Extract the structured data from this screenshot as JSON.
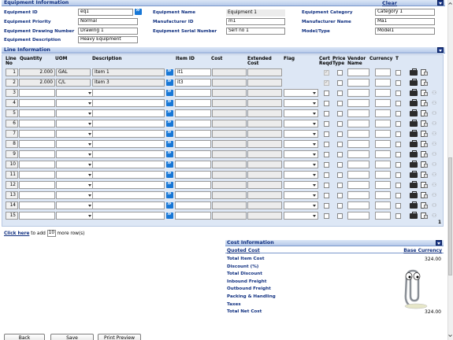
{
  "equipment": {
    "section_title": "Equipment Information",
    "clear_label": "Clear",
    "fields": {
      "equipment_id": {
        "label": "Equipment ID",
        "value": "eq1"
      },
      "equipment_priority": {
        "label": "Equipment Priority",
        "value": "Normal"
      },
      "drawing_number": {
        "label": "Equipment Drawing Number",
        "value": "Drawing 1"
      },
      "description": {
        "label": "Equipment Description",
        "value": "Heavy Equipment"
      },
      "equipment_name": {
        "label": "Equipment Name",
        "value": "Equipment 1"
      },
      "manufacturer_id": {
        "label": "Manufacturer ID",
        "value": "m1"
      },
      "serial_number": {
        "label": "Equipment Serial Number",
        "value": "Serl no 1"
      },
      "category": {
        "label": "Equipment Category",
        "value": "Category 1"
      },
      "manufacturer_name": {
        "label": "Manufacturer Name",
        "value": "Ma1"
      },
      "model_type": {
        "label": "Model/Type",
        "value": "Model1"
      }
    }
  },
  "lines": {
    "section_title": "Line Information",
    "headers": {
      "line_no": "Line No",
      "quantity": "Quantity",
      "uom": "UOM",
      "description": "Description",
      "item_id": "Item ID",
      "cost": "Cost",
      "extended_cost": "Extended Cost",
      "flag": "Flag",
      "cert_reqd": "Cert Reqd",
      "price_type": "Price Type",
      "vendor_name": "Vendor Name",
      "currency": "Currency",
      "t": "T"
    },
    "rows": [
      {
        "no": "1",
        "qty": "2.000",
        "uom": "GAL",
        "desc": "Item 1",
        "item": "it1"
      },
      {
        "no": "2",
        "qty": "2.000",
        "uom": "C/L",
        "desc": "Item 3",
        "item": "it3"
      },
      {
        "no": "3"
      },
      {
        "no": "4"
      },
      {
        "no": "5"
      },
      {
        "no": "6"
      },
      {
        "no": "7"
      },
      {
        "no": "8"
      },
      {
        "no": "9"
      },
      {
        "no": "10"
      },
      {
        "no": "11"
      },
      {
        "no": "12"
      },
      {
        "no": "13"
      },
      {
        "no": "14"
      },
      {
        "no": "15"
      }
    ],
    "page_indicator": "1",
    "add_more": {
      "link": "Click here",
      "to_add": "to add",
      "count": "10",
      "suffix": "more row(s)"
    }
  },
  "cost": {
    "section_title": "Cost Information",
    "quoted_cost_label": "Quoted Cost",
    "base_currency_label": "Base Currency",
    "rows": [
      {
        "label": "Total Item Cost",
        "value": "324.00"
      },
      {
        "label": "Discount (%)",
        "value": ""
      },
      {
        "label": "Total Discount",
        "value": ""
      },
      {
        "label": "Inbound Freight",
        "value": ""
      },
      {
        "label": "Outbound Freight",
        "value": ""
      },
      {
        "label": "Packing & Handling",
        "value": ""
      },
      {
        "label": "Taxes",
        "value": ""
      },
      {
        "label": "Total Net Cost",
        "value": "324.00"
      }
    ]
  },
  "buttons": {
    "back": "Back",
    "save": "Save",
    "print_preview": "Print Preview"
  },
  "colors": {
    "accent": "#103080",
    "lookup": "#1777d6",
    "header_bg": "#c6d6ef"
  },
  "icons": [
    "lookup-arrow-icon",
    "briefcase-icon",
    "note-icon",
    "people-icon",
    "collapse-icon",
    "paperclip-assistant-icon"
  ]
}
